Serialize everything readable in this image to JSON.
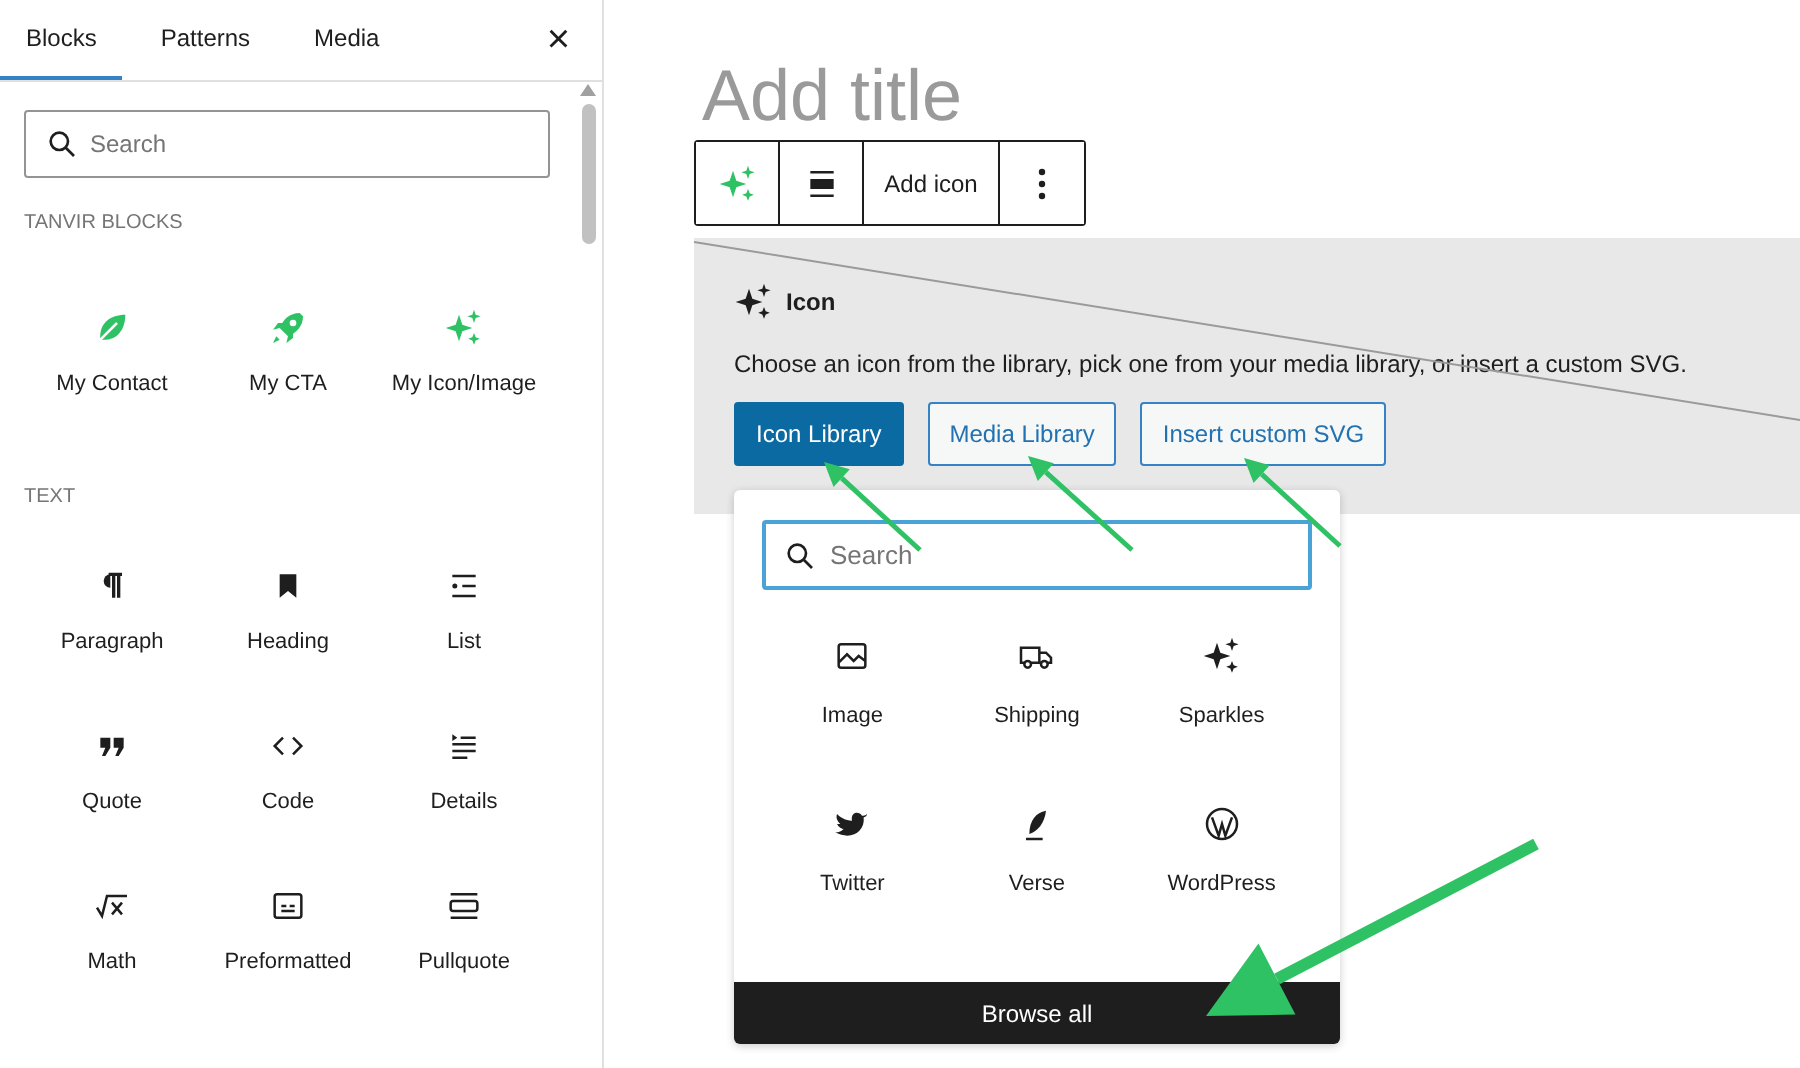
{
  "sidebar": {
    "tabs": [
      {
        "label": "Blocks",
        "selected": true
      },
      {
        "label": "Patterns",
        "selected": false
      },
      {
        "label": "Media",
        "selected": false
      }
    ],
    "close": "×",
    "search": {
      "placeholder": "Search"
    },
    "categories": [
      {
        "title": "TANVIR BLOCKS",
        "blocks": [
          {
            "label": "My Contact"
          },
          {
            "label": "My CTA"
          },
          {
            "label": "My Icon/Image"
          }
        ]
      },
      {
        "title": "TEXT",
        "blocks": [
          {
            "label": "Paragraph"
          },
          {
            "label": "Heading"
          },
          {
            "label": "List"
          },
          {
            "label": "Quote"
          },
          {
            "label": "Code"
          },
          {
            "label": "Details"
          },
          {
            "label": "Math"
          },
          {
            "label": "Preformatted"
          },
          {
            "label": "Pullquote"
          }
        ]
      }
    ]
  },
  "editor": {
    "title_placeholder": "Add title",
    "toolbar": {
      "label": "Add icon"
    },
    "block": {
      "title": "Icon",
      "description": "Choose an icon from the library, pick one from your media library, or insert a custom SVG.",
      "buttons": [
        {
          "label": "Icon Library",
          "selected": true
        },
        {
          "label": "Media Library",
          "selected": false
        },
        {
          "label": "Insert custom SVG",
          "selected": false
        }
      ]
    },
    "picker": {
      "search": {
        "placeholder": "Search"
      },
      "icons": [
        {
          "label": "Image"
        },
        {
          "label": "Shipping"
        },
        {
          "label": "Sparkles"
        },
        {
          "label": "Twitter"
        },
        {
          "label": "Verse"
        },
        {
          "label": "WordPress"
        }
      ],
      "browse": "Browse all"
    }
  }
}
